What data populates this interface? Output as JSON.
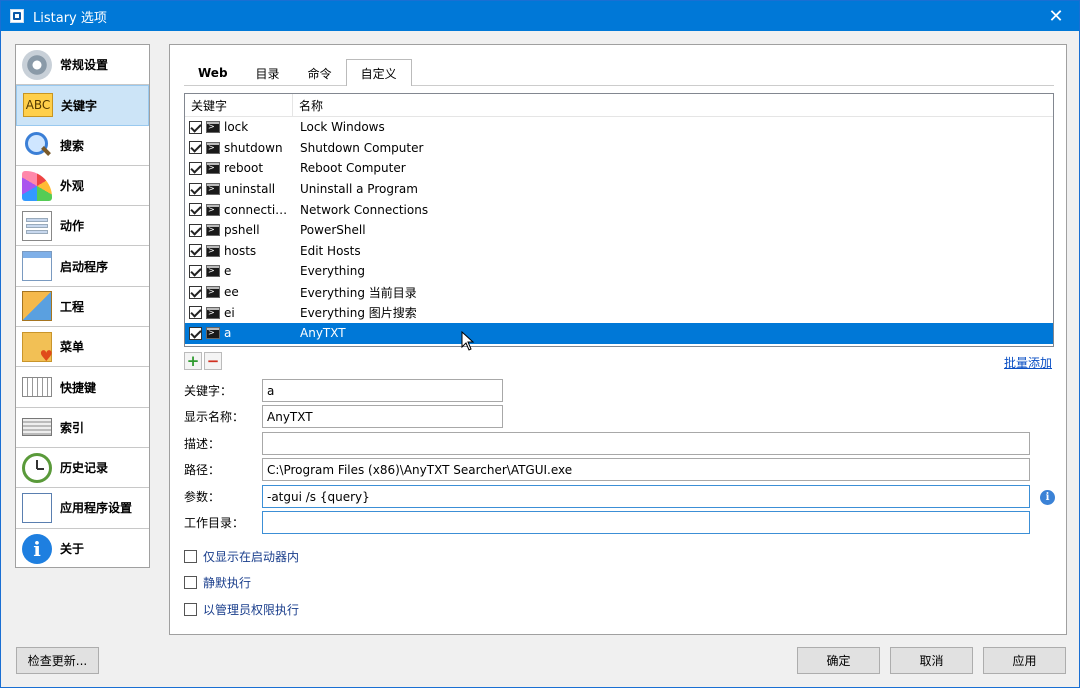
{
  "window": {
    "title": "Listary 选项",
    "close_glyph": "✕"
  },
  "sidebar": {
    "items": [
      {
        "label": "常规设置",
        "icon": "gear-icon"
      },
      {
        "label": "关键字",
        "icon": "abc-icon",
        "icon_text": "ABC",
        "selected": true
      },
      {
        "label": "搜索",
        "icon": "magnifier-icon"
      },
      {
        "label": "外观",
        "icon": "color-palette-icon"
      },
      {
        "label": "动作",
        "icon": "action-list-icon"
      },
      {
        "label": "启动程序",
        "icon": "launcher-window-icon"
      },
      {
        "label": "工程",
        "icon": "project-boxes-icon"
      },
      {
        "label": "菜单",
        "icon": "menu-folder-heart-icon"
      },
      {
        "label": "快捷键",
        "icon": "keyboard-icon"
      },
      {
        "label": "索引",
        "icon": "index-drive-icon"
      },
      {
        "label": "历史记录",
        "icon": "history-clock-icon"
      },
      {
        "label": "应用程序设置",
        "icon": "app-settings-icon"
      },
      {
        "label": "关于",
        "icon": "info-icon",
        "icon_text": "i"
      }
    ]
  },
  "tabs": [
    {
      "label": "Web"
    },
    {
      "label": "目录"
    },
    {
      "label": "命令"
    },
    {
      "label": "自定义",
      "active": true
    }
  ],
  "list": {
    "headers": {
      "keyword": "关键字",
      "name": "名称"
    },
    "rows": [
      {
        "keyword": "lock",
        "name": "Lock Windows",
        "checked": true
      },
      {
        "keyword": "shutdown",
        "name": "Shutdown Computer",
        "checked": true
      },
      {
        "keyword": "reboot",
        "name": "Reboot Computer",
        "checked": true
      },
      {
        "keyword": "uninstall",
        "name": "Uninstall a Program",
        "checked": true
      },
      {
        "keyword": "connectio...",
        "name": "Network Connections",
        "checked": true
      },
      {
        "keyword": "pshell",
        "name": "PowerShell",
        "checked": true
      },
      {
        "keyword": "hosts",
        "name": "Edit Hosts",
        "checked": true
      },
      {
        "keyword": "e",
        "name": "Everything",
        "checked": true
      },
      {
        "keyword": "ee",
        "name": "Everything 当前目录",
        "checked": true
      },
      {
        "keyword": "ei",
        "name": "Everything 图片搜索",
        "checked": true
      },
      {
        "keyword": "a",
        "name": "AnyTXT",
        "checked": true,
        "selected": true
      }
    ]
  },
  "toolbar": {
    "add_glyph": "+",
    "remove_glyph": "−",
    "batch_add": "批量添加"
  },
  "form": {
    "keyword": {
      "label": "关键字：",
      "value": "a"
    },
    "display_name": {
      "label": "显示名称：",
      "value": "AnyTXT"
    },
    "description": {
      "label": "描述：",
      "value": ""
    },
    "path": {
      "label": "路径：",
      "value": "C:\\Program Files (x86)\\AnyTXT Searcher\\ATGUI.exe"
    },
    "params": {
      "label": "参数：",
      "value": "-atgui /s {query}"
    },
    "workdir": {
      "label": "工作目录：",
      "value": ""
    },
    "info_glyph": "i"
  },
  "options": [
    {
      "label": "仅显示在启动器内",
      "checked": false
    },
    {
      "label": "静默执行",
      "checked": false
    },
    {
      "label": "以管理员权限执行",
      "checked": false
    }
  ],
  "buttons": {
    "check_update": "检查更新...",
    "ok": "确定",
    "cancel": "取消",
    "apply": "应用"
  }
}
